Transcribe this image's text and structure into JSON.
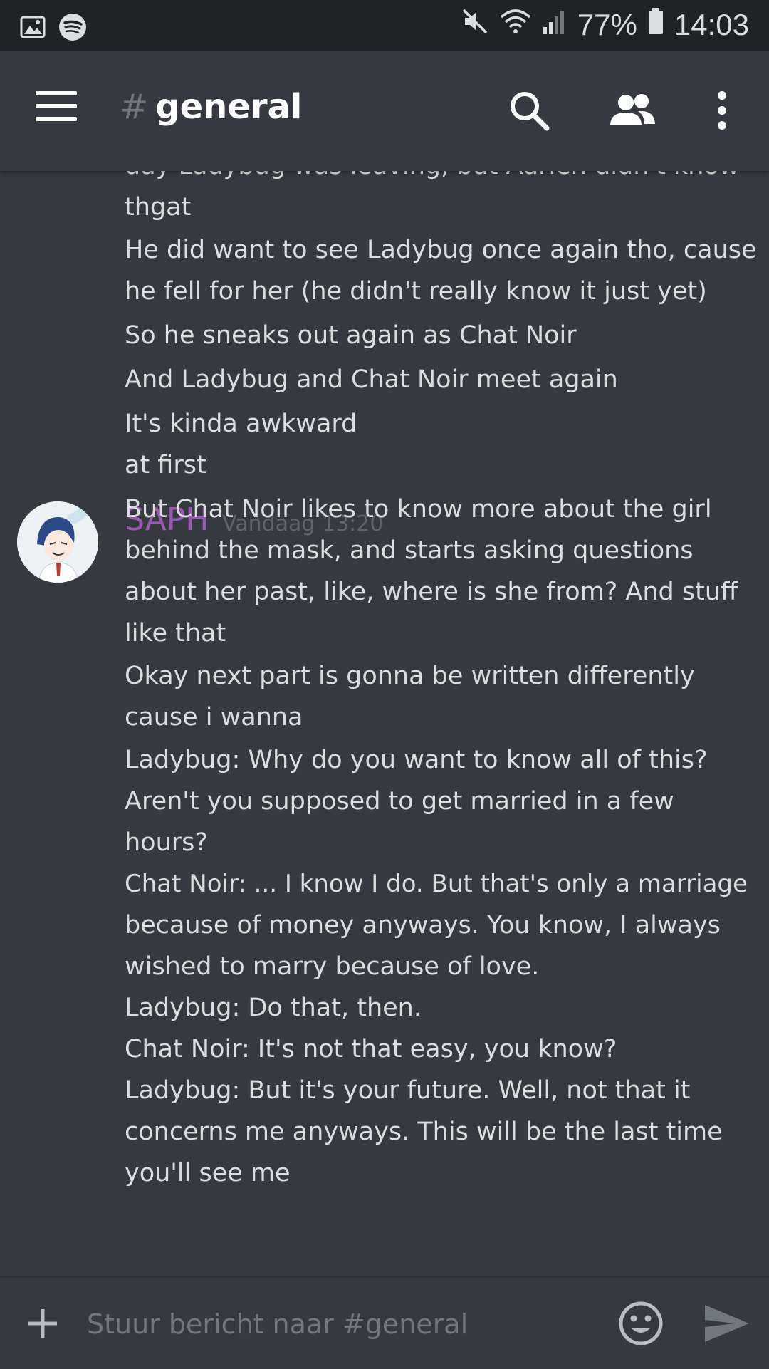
{
  "status_bar": {
    "battery": "77%",
    "time": "14:03",
    "icons": [
      "image-icon",
      "spotify-icon",
      "mute-icon",
      "wifi-icon",
      "signal-icon",
      "battery-icon"
    ]
  },
  "header": {
    "hash": "#",
    "channel": "general",
    "icons": [
      "menu-icon",
      "search-icon",
      "members-icon",
      "more-icon"
    ]
  },
  "messages": {
    "previous_lines": [
      "day Ladybug was leaving, but Adrien didn't know",
      "thgat",
      "He did want to see Ladybug once again tho, cause",
      "he fell for her (he didn't really know it just yet)",
      "So he sneaks out again as Chat Noir",
      "And Ladybug and Chat Noir meet again",
      "It's kinda awkward"
    ],
    "group": {
      "author": "SAPH",
      "timestamp": "Vandaag 13:20",
      "author_color": "#9b59b6",
      "lines": [
        "at first",
        "But Chat Noir likes to know more about the girl",
        "behind the mask, and starts asking questions",
        "about her past, like, where is she from? And stuff",
        "like that",
        "Okay next part is gonna be written differently",
        "cause i wanna",
        "Ladybug: Why do you want to know all of this?",
        "Aren't you supposed to get married in a few",
        "hours?",
        "Chat Noir: ... I know I do. But that's only a marriage",
        "because of money anyways. You know, I always",
        "wished to marry because of love.",
        "Ladybug: Do that, then.",
        "Chat Noir: It's not that easy, you know?",
        "Ladybug: But it's your future. Well, not that it",
        "concerns me anyways. This will be the last time",
        "you'll see me"
      ]
    }
  },
  "composer": {
    "placeholder": "Stuur bericht naar #general"
  },
  "colors": {
    "background": "#36393f",
    "status_bar": "#202225",
    "text": "#dcddde",
    "muted": "#72767d"
  }
}
